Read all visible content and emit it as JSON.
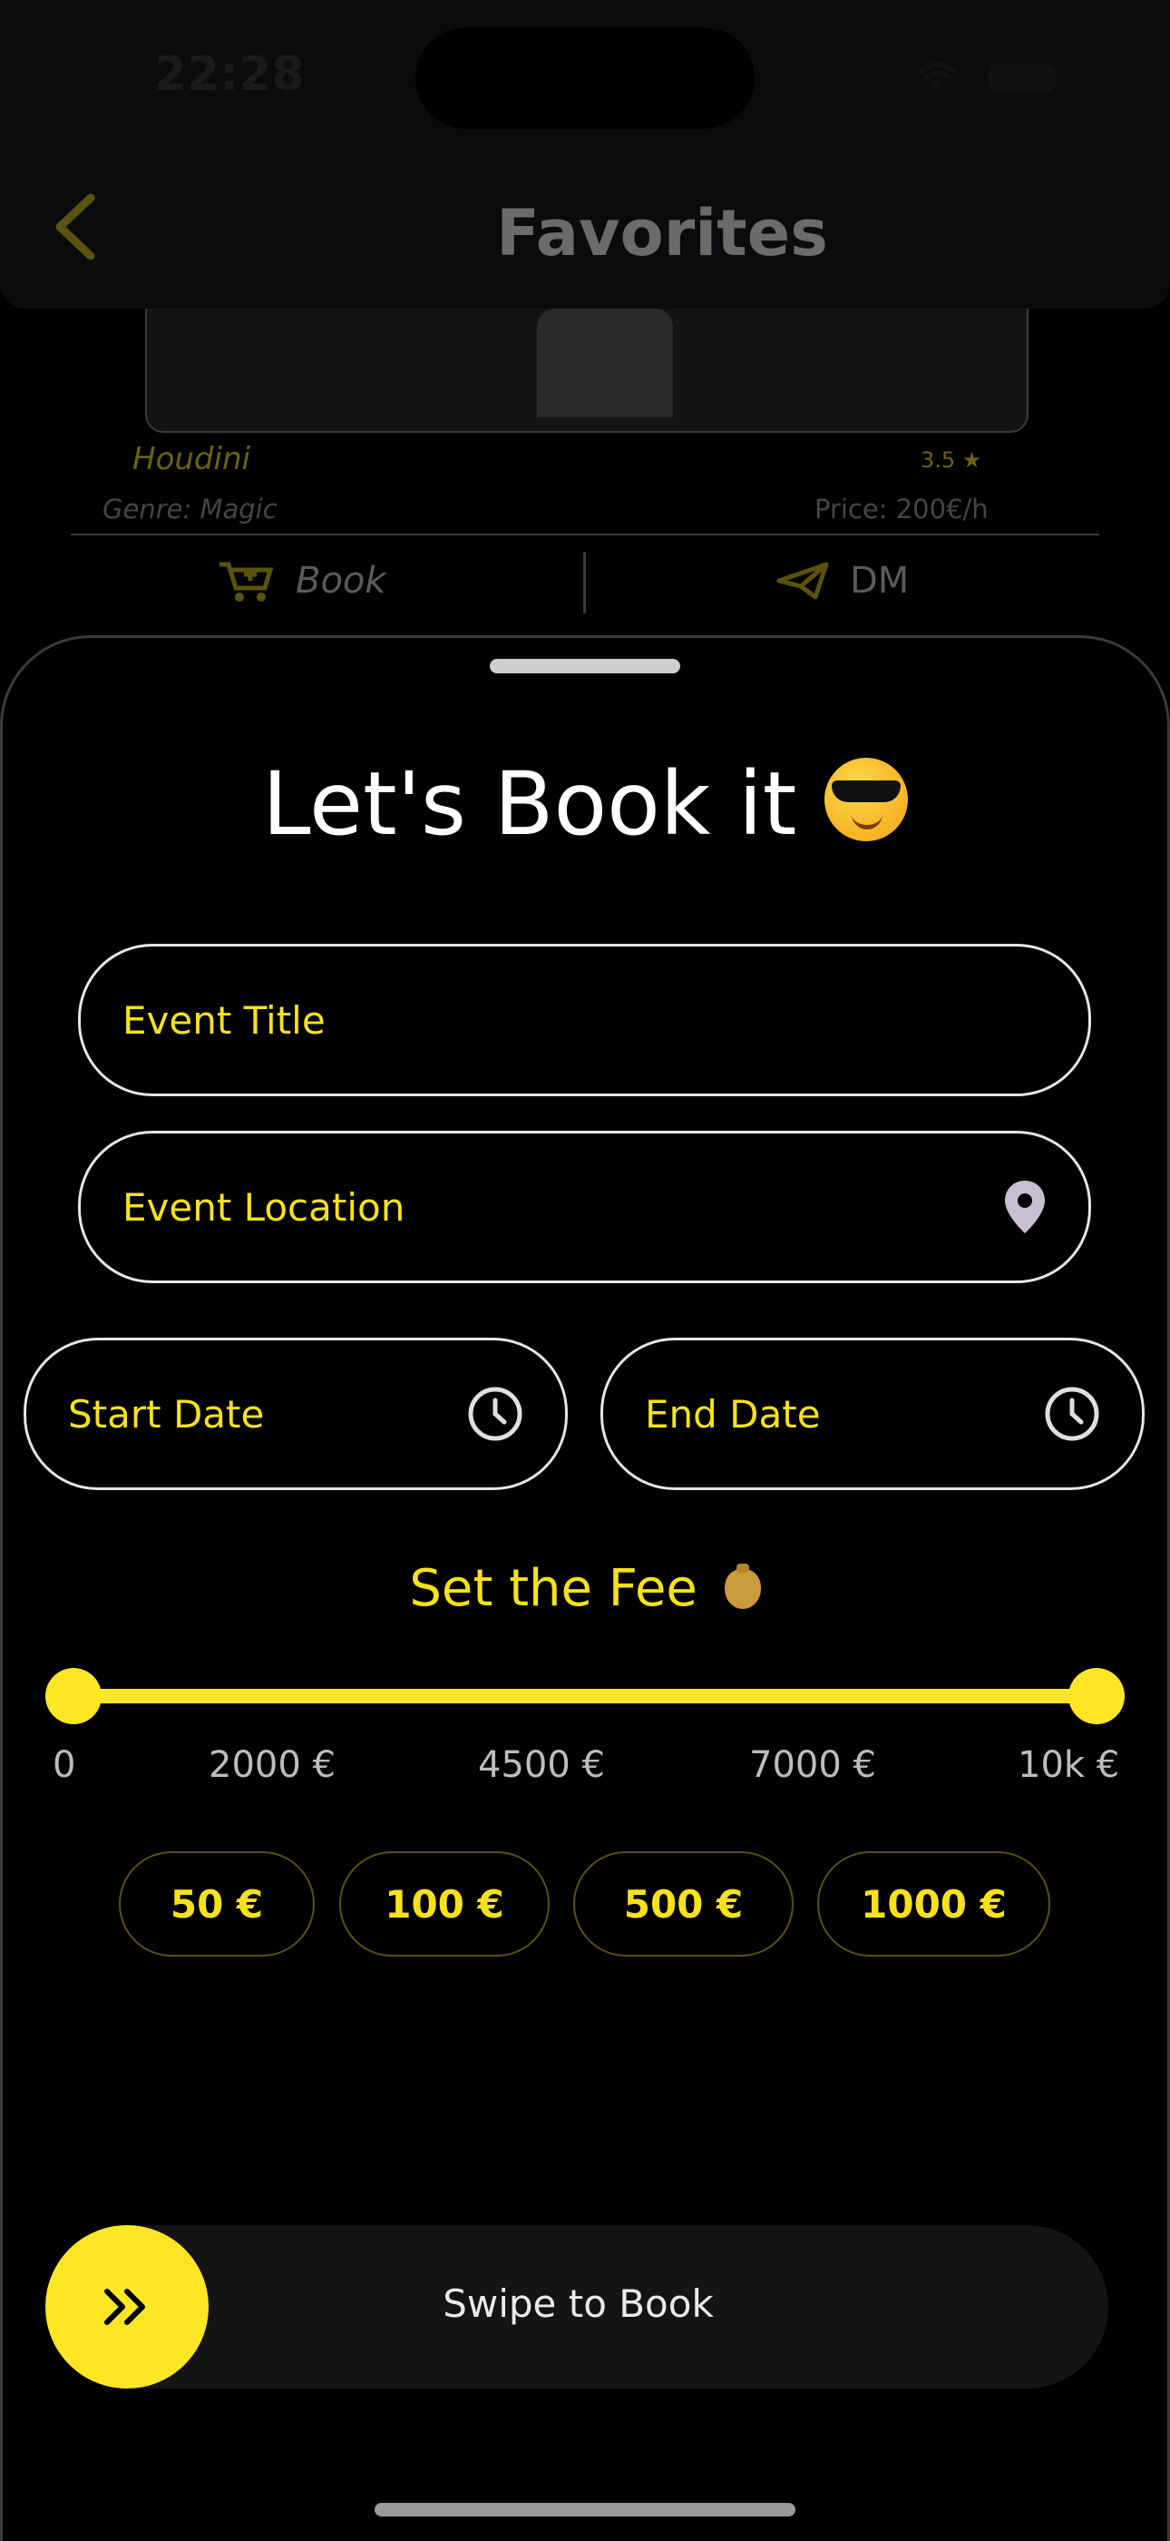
{
  "status_bar": {
    "time": "22:28"
  },
  "header": {
    "title": "Favorites"
  },
  "card": {
    "name": "Houdini",
    "rating": "3.5 ★",
    "genre": "Genre: Magic",
    "price": "Price: 200€/h",
    "book_label": "Book",
    "dm_label": "DM"
  },
  "sheet": {
    "title": "Let's Book it",
    "event_title_placeholder": "Event Title",
    "event_location_placeholder": "Event Location",
    "start_date_placeholder": "Start Date",
    "end_date_placeholder": "End Date",
    "fee_label": "Set the Fee",
    "fee_range": {
      "min_selected": 0,
      "max_selected": 10000
    },
    "ticks": [
      "0",
      "2000 €",
      "4500 €",
      "7000 €",
      "10k €"
    ],
    "quick_fees": [
      "50 €",
      "100 €",
      "500 €",
      "1000 €"
    ],
    "swipe_label": "Swipe to Book"
  },
  "colors": {
    "accent": "#fde725",
    "background": "#000000"
  },
  "icons": [
    "back-chevron-icon",
    "cart-icon",
    "paper-plane-icon",
    "location-pin-icon",
    "clock-icon",
    "double-chevron-right-icon",
    "sunglasses-emoji",
    "money-bag-emoji"
  ]
}
